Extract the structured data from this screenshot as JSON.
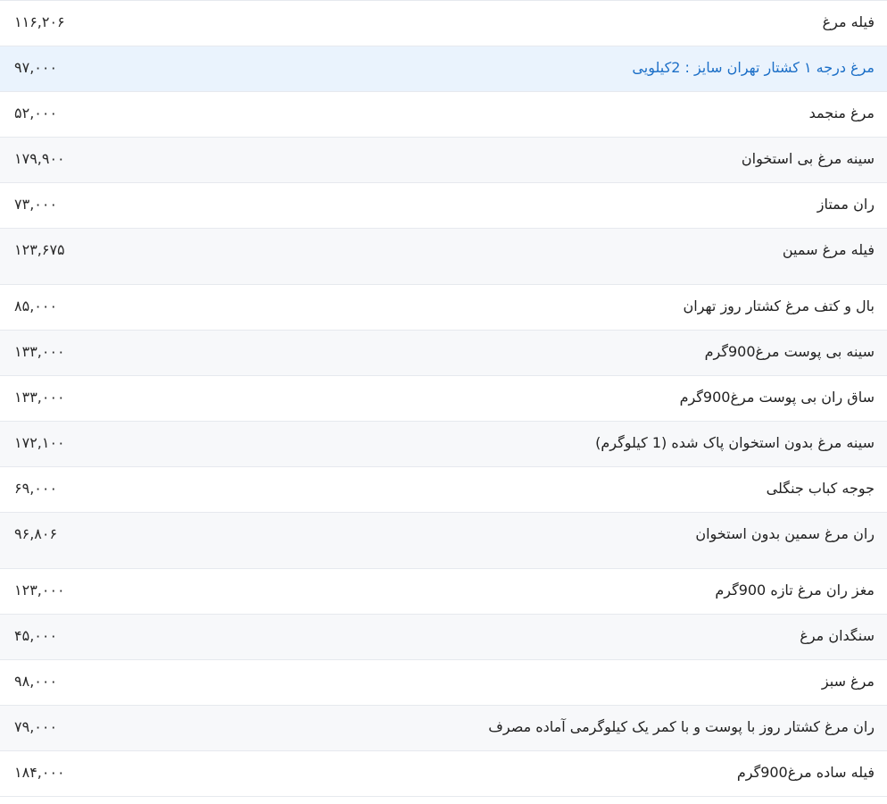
{
  "rows": [
    {
      "name": "فیله مرغ",
      "price": "۱۱۶,۲۰۶"
    },
    {
      "name": "مرغ درجه ۱ کشتار تهران سایز : 2کیلویی",
      "price": "۹۷,۰۰۰"
    },
    {
      "name": "مرغ منجمد",
      "price": "۵۲,۰۰۰"
    },
    {
      "name": "سینه مرغ بی استخوان",
      "price": "۱۷۹,۹۰۰"
    },
    {
      "name": "ران ممتاز",
      "price": "۷۳,۰۰۰"
    },
    {
      "name": "فیله مرغ سمین",
      "price": "۱۲۳,۶۷۵"
    },
    {
      "name": "بال و کتف مرغ کشتار روز تهران",
      "price": "۸۵,۰۰۰"
    },
    {
      "name": "سینه بی پوست مرغ900گرم",
      "price": "۱۳۳,۰۰۰"
    },
    {
      "name": "ساق ران بی پوست مرغ900گرم",
      "price": "۱۳۳,۰۰۰"
    },
    {
      "name": "سینه مرغ بدون استخوان پاک شده (1 کیلوگرم)",
      "price": "۱۷۲,۱۰۰"
    },
    {
      "name": "جوجه کباب جنگلی",
      "price": "۶۹,۰۰۰"
    },
    {
      "name": "ران مرغ سمین بدون استخوان",
      "price": "۹۶,۸۰۶"
    },
    {
      "name": "مغز ران مرغ تازه 900گرم",
      "price": "۱۲۳,۰۰۰"
    },
    {
      "name": "سنگدان مرغ",
      "price": "۴۵,۰۰۰"
    },
    {
      "name": "مرغ سبز",
      "price": "۹۸,۰۰۰"
    },
    {
      "name": "ران مرغ کشتار روز با پوست و با کمر یک کیلوگرمی آماده مصرف",
      "price": "۷۹,۰۰۰"
    },
    {
      "name": "فیله ساده مرغ900گرم",
      "price": "۱۸۴,۰۰۰"
    }
  ],
  "colors": {
    "link": "#1c6fc7",
    "highlight_row": "#eaf3fd",
    "alt_row": "#f7f8fa",
    "border": "#e6e9ee"
  }
}
